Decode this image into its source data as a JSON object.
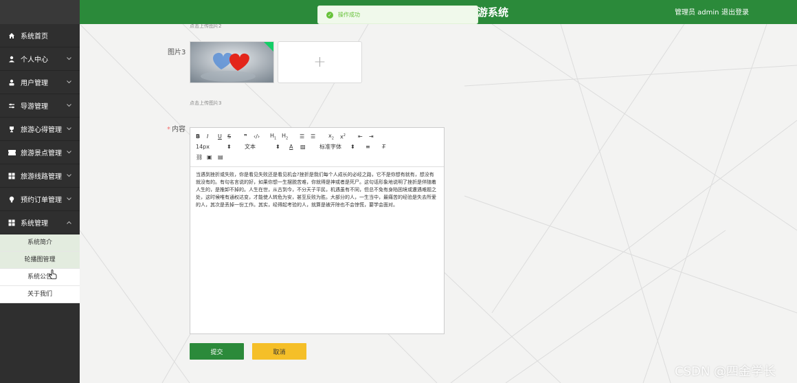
{
  "header": {
    "title": "游系统",
    "user": "管理员 admin",
    "logout": "退出登录"
  },
  "toast": {
    "message": "操作成功"
  },
  "sidebar": {
    "items": [
      {
        "label": "系统首页",
        "icon": "home-icon"
      },
      {
        "label": "个人中心",
        "icon": "person-icon"
      },
      {
        "label": "用户管理",
        "icon": "user-icon"
      },
      {
        "label": "导游管理",
        "icon": "sliders-icon"
      },
      {
        "label": "旅游心得管理",
        "icon": "trophy-icon"
      },
      {
        "label": "旅游景点管理",
        "icon": "ticket-icon"
      },
      {
        "label": "旅游线路管理",
        "icon": "grid-icon"
      },
      {
        "label": "预约订单管理",
        "icon": "bulb-icon"
      },
      {
        "label": "系统管理",
        "icon": "grid-icon"
      }
    ],
    "submenu": [
      "系统简介",
      "轮播图管理",
      "系统公告",
      "关于我们"
    ]
  },
  "form": {
    "hint2": "点击上传图片2",
    "image3_label": "图片3",
    "hint3": "点击上传图片3",
    "content_label": "内容",
    "required_mark": "*",
    "uploader_plus": "+"
  },
  "editor": {
    "font_size": "14px",
    "text_type": "文本",
    "font_family": "标准字体",
    "content": "当遇到挫折或失败，你是看见失败还是看见机会?挫折是我们每个人成长的必经之路，它不是你想有就有，想没有就没有的。有句名言说的好，如果你想一生摆脱苦难，你就得是神或者是死尸。这句话形象地说明了挫折是伴随着人生的，是推卸不掉的。人生在世，从古到今，不分天子平民，机遇虽有不同，但总不免有身陷困境或遭遇难题之处，这时候唯有通权达变，才能使人转危为安，甚至反败为胜。大部分的人，一生当中，最痛苦的经验是失去所爱的人，其次是丢掉一份工作。其实，经得起考验的人，就算是被开除也不会惊慌，要学会面对。"
  },
  "buttons": {
    "submit": "提交",
    "cancel": "取消"
  },
  "watermark": "CSDN @四金学长",
  "colors": {
    "primary": "#2b8a3a",
    "warning": "#f5bf28",
    "sidebar": "#2f2f2f"
  }
}
